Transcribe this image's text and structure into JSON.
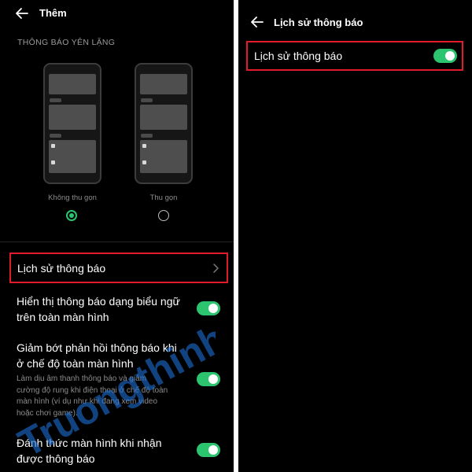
{
  "left_screen": {
    "header": {
      "title": "Thêm"
    },
    "section_label": "THÔNG BÁO YÊN LẶNG",
    "layout_options": [
      {
        "caption": "Không thu gọn",
        "selected": true
      },
      {
        "caption": "Thu gọn",
        "selected": false
      }
    ],
    "notification_history": {
      "label": "Lịch sử thông báo"
    },
    "settings": [
      {
        "title_line1": "Hiển thị thông báo dạng biểu ngữ",
        "title_line2": "trên toàn màn hình",
        "enabled": true
      },
      {
        "title_line1": "Giảm bớt phản hồi thông báo khi",
        "title_line2": "ở chế độ toàn màn hình",
        "description": [
          "Làm dịu âm thanh thông báo và giảm",
          "cường độ rung khi điện thoại ở chế độ toàn",
          "màn hình (ví dụ như khi đang xem video",
          "hoặc chơi game)."
        ],
        "enabled": true
      },
      {
        "title_line1": "Đánh thức màn hình khi nhận",
        "title_line2": "được thông báo",
        "enabled": true
      }
    ]
  },
  "right_screen": {
    "header": {
      "title": "Lịch sử thông báo"
    },
    "toggle_row": {
      "label": "Lịch sử thông báo",
      "enabled": true
    }
  },
  "watermark": {
    "text": "Truongthinh.top"
  },
  "colors": {
    "background": "#000000",
    "accent_green": "#2cc46e",
    "highlight_red": "#e21b2b",
    "watermark_blue": "#1d6fd6"
  },
  "icons": {
    "back": "arrow-left-icon",
    "chevron": "chevron-right-icon"
  }
}
